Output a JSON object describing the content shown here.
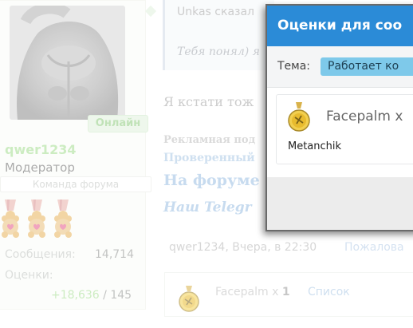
{
  "user": {
    "online_badge": "Онлайн",
    "name": "qwer1234",
    "role": "Модератор",
    "team": "Команда форума",
    "medals": [
      "bear-medal-icon",
      "bear-medal-icon",
      "bear-medal-icon"
    ],
    "messages_label": "Сообщения:",
    "messages_value": "14,714",
    "ratings_label": "Оценки:",
    "ratings_positive": "+18,636",
    "ratings_separator": " / ",
    "ratings_total": "145"
  },
  "post": {
    "quote_author": "Unkas сказал",
    "quote_text": "Тебя понял) я",
    "body": "Я кстати тож",
    "ad_title": "Рекламная под",
    "ad_link1": "Проверенный",
    "ad_link2": "На форуме",
    "ad_link3": "Наш Telegr",
    "meta": "qwer1234, Вчера, в 22:30",
    "complain": "Пожалова",
    "reaction_icon": "facepalm-medal-icon",
    "reaction_name": "Facepalm x",
    "reaction_count": "1",
    "reaction_list": "Список"
  },
  "modal": {
    "title": "Оценки для соо",
    "topic_label": "Тема:",
    "topic_value": "Работает ко",
    "reaction_icon": "facepalm-medal-icon",
    "reaction_title": "Facepalm x",
    "reaction_user": "Metanchik"
  },
  "colors": {
    "accent": "#2b8bd7",
    "online": "#a3dd8f",
    "link": "#99bde2"
  }
}
